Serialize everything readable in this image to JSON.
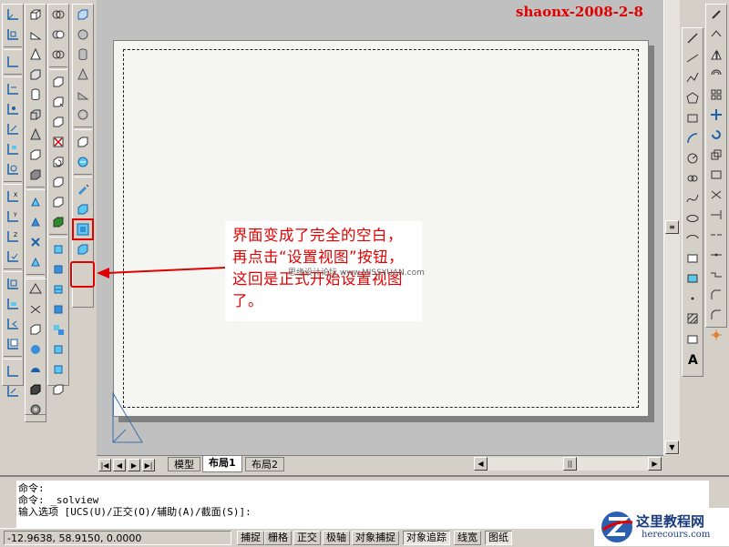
{
  "watermark": "shaonx-2008-2-8",
  "callout": {
    "text": "界面变成了完全的空白，再点击“设置视图”按钮，这回是正式开始设置视图了。",
    "overlay": "思缘设计论坛 www.MISSYUAN.com"
  },
  "tabs": [
    {
      "label": "模型"
    },
    {
      "label": "布局1"
    },
    {
      "label": "布局2"
    }
  ],
  "command": {
    "line1": "命令:",
    "line2": "命令: _solview",
    "line3": "输入选项 [UCS(U)/正交(O)/辅助(A)/截面(S)]:"
  },
  "status": {
    "coords": "-12.9638, 58.9150, 0.0000",
    "buttons": [
      "捕捉",
      "栅格",
      "正交",
      "极轴",
      "对象捕捉",
      "对象追踪",
      "线宽",
      "图纸"
    ]
  },
  "logo": {
    "title": "这里教程网",
    "url": "herecours.com"
  },
  "colors": {
    "accent": "#e00000",
    "icon_blue": "#3a8fd8",
    "icon_cyan": "#5cc8f0"
  }
}
